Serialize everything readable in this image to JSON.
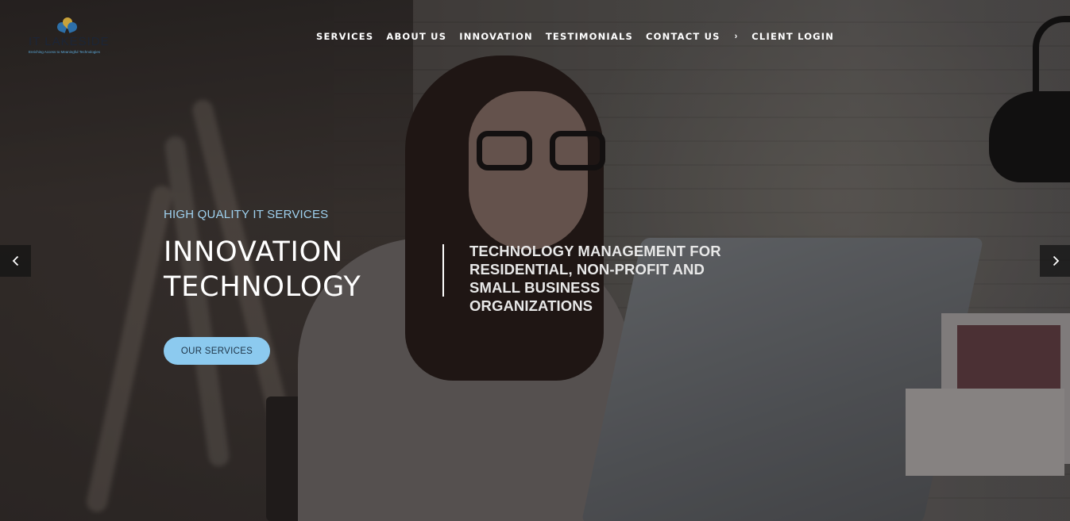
{
  "brand": {
    "logo_text": "IT LAKESIDE",
    "tagline": "Enriching Access to Meaningful Technologies"
  },
  "nav": {
    "items": [
      {
        "label": "SERVICES"
      },
      {
        "label": "ABOUT US"
      },
      {
        "label": "INNOVATION"
      },
      {
        "label": "TESTIMONIALS"
      },
      {
        "label": "CONTACT US"
      }
    ],
    "separator": "›",
    "client_login": "CLIENT LOGIN"
  },
  "hero": {
    "eyebrow": "HIGH QUALITY IT SERVICES",
    "headline_line1": "INNOVATION",
    "headline_line2": "TECHNOLOGY",
    "tagline_lines": [
      "TECHNOLOGY MANAGEMENT FOR",
      "RESIDENTIAL, NON-PROFIT AND",
      "SMALL BUSINESS",
      "ORGANIZATIONS"
    ],
    "cta_label": "OUR SERVICES"
  },
  "slider": {
    "prev_icon": "chevron-left-icon",
    "next_icon": "chevron-right-icon"
  },
  "colors": {
    "accent": "#8ccaef",
    "eyebrow": "#9fd1ef",
    "text": "#ffffff",
    "arrow_bg": "#1a1a1a"
  }
}
